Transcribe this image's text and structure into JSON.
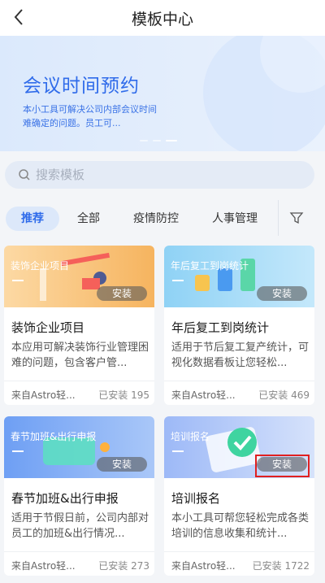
{
  "header": {
    "title": "模板中心"
  },
  "banner": {
    "title": "会议时间预约",
    "desc": "本小工具可解决公司内部会议时间难确定的问题。员工可..."
  },
  "search": {
    "placeholder": "搜索模板"
  },
  "tabs": [
    {
      "label": "推荐",
      "active": true
    },
    {
      "label": "全部"
    },
    {
      "label": "疫情防控"
    },
    {
      "label": "人事管理"
    }
  ],
  "install_label": "安装",
  "cards": [
    {
      "tag": "装饰企业项目",
      "name": "装饰企业项目",
      "desc": "本应用可解决装饰行业管理困难的问题，包含客户管...",
      "source": "来自Astro轻...",
      "count": "已安装 195"
    },
    {
      "tag": "年后复工到岗统计",
      "name": "年后复工到岗统计",
      "desc": "适用于节后复工复产统计，可视化数据看板让您轻松...",
      "source": "来自Astro轻...",
      "count": "已安装 469"
    },
    {
      "tag": "春节加班&出行申报",
      "name": "春节加班&出行申报",
      "desc": "适用于节假日前，公司内部对员工的加班&出行情况...",
      "source": "来自Astro轻...",
      "count": "已安装 273"
    },
    {
      "tag": "培训报名",
      "name": "培训报名",
      "desc": "本小工具可帮您轻松完成各类培训的信息收集和统计...",
      "source": "来自Astro轻...",
      "count": "已安装 1722"
    }
  ],
  "colors": {
    "accent": "#2f6bea",
    "highlight": "#e02020"
  }
}
